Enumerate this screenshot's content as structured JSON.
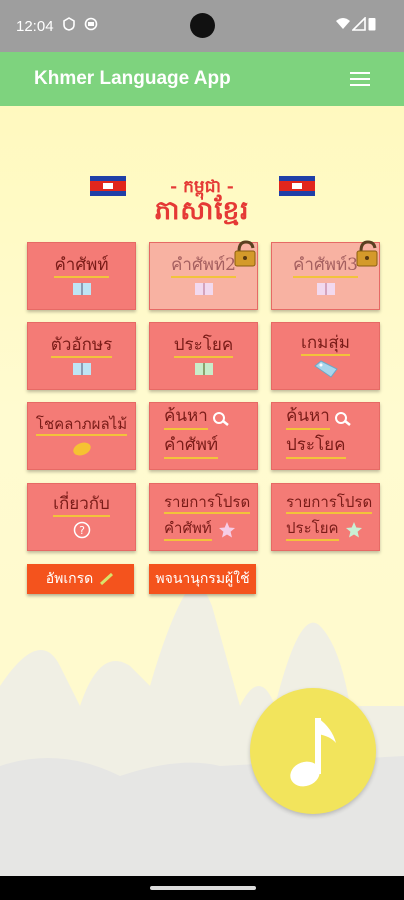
{
  "status_bar": {
    "time": "12:04"
  },
  "app_bar": {
    "title": "Khmer Language App",
    "menu_icon": "hamburger-menu-icon"
  },
  "logo": {
    "line1": "- កម្ពុជា -",
    "line2": "ភាសាខ្មែរ"
  },
  "tiles": [
    {
      "label": "คำศัพท์",
      "icon": "book-icon",
      "locked": false
    },
    {
      "label": "คำศัพท์2",
      "icon": "book-icon",
      "locked": true
    },
    {
      "label": "คำศัพท์3",
      "icon": "book-icon",
      "locked": true
    },
    {
      "label": "ตัวอักษร",
      "icon": "book-icon",
      "locked": false
    },
    {
      "label": "ประโยค",
      "icon": "book-icon",
      "locked": false
    },
    {
      "label": "เกมสุ่ม",
      "icon": "tag-icon",
      "locked": false
    },
    {
      "label": "โชคลาภผลไม้",
      "icon": "mango-icon",
      "locked": false
    },
    {
      "label1": "ค้นหา",
      "label2": "คำศัพท์",
      "icon": "search-icon"
    },
    {
      "label1": "ค้นหา",
      "label2": "ประโยค",
      "icon": "search-icon"
    },
    {
      "label": "เกี่ยวกับ",
      "icon": "question-icon"
    },
    {
      "label1": "รายการโปรด",
      "label2": "คำศัพท์",
      "icon": "star-icon"
    },
    {
      "label1": "รายการโปรด",
      "label2": "ประโยค",
      "icon": "star-icon"
    }
  ],
  "buttons": {
    "upgrade": "อัพเกรด",
    "dictionary": "พจนานุกรมผู้ใช้"
  },
  "colors": {
    "app_bar": "#7ed37e",
    "tile": "#f47b76",
    "tile_locked": "#f8b2a2",
    "underline": "#f2c33b",
    "button": "#f4531d",
    "fab": "#f2e45c"
  }
}
